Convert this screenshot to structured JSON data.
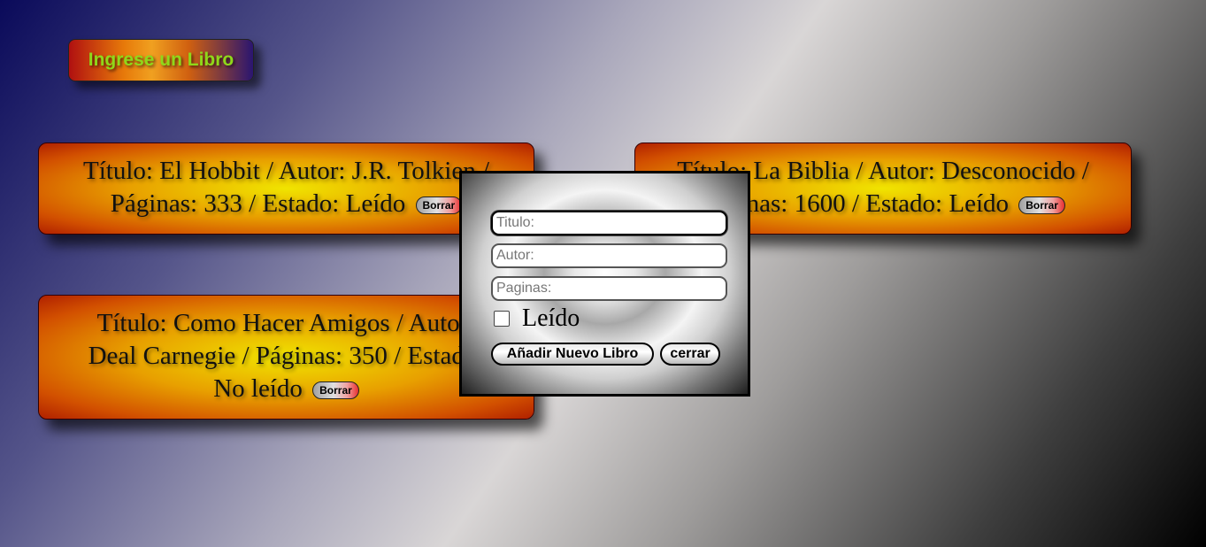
{
  "header": {
    "add_book_label": "Ingrese un Libro"
  },
  "books": [
    {
      "text_line1": "Título: El Hobbit / Autor: J.R. Tolkien /",
      "text_line2": "Páginas: 333 / Estado: Leído",
      "delete_label": "Borrar"
    },
    {
      "text_line1": "Título: La Biblia / Autor: Desconocido /",
      "text_line2": "Páginas: 1600 / Estado: Leído",
      "delete_label": "Borrar"
    },
    {
      "text_line1": "Título: Como Hacer Amigos / Autor:",
      "text_line2": "Deal Carnegie / Páginas: 350 / Estado:",
      "text_line3": "No leído",
      "delete_label": "Borrar"
    }
  ],
  "modal": {
    "title_placeholder": "Titulo:",
    "author_placeholder": "Autor:",
    "pages_placeholder": "Paginas:",
    "read_label": "Leído",
    "read_checked": false,
    "add_button_label": "Añadir Nuevo Libro",
    "close_button_label": "cerrar"
  }
}
